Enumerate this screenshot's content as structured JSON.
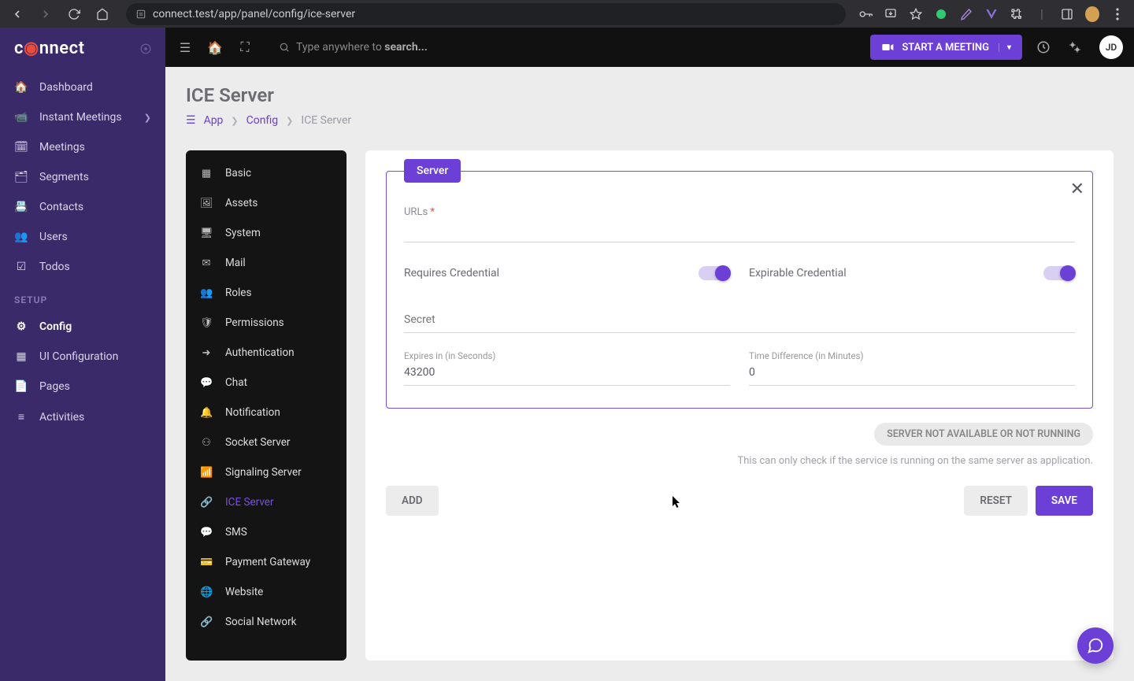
{
  "browser": {
    "url": "connect.test/app/panel/config/ice-server"
  },
  "app": {
    "logo": "connect"
  },
  "sidebar": {
    "items": [
      {
        "icon": "home",
        "label": "Dashboard"
      },
      {
        "icon": "video",
        "label": "Instant Meetings",
        "hasChildren": true
      },
      {
        "icon": "calendar",
        "label": "Meetings"
      },
      {
        "icon": "segments",
        "label": "Segments"
      },
      {
        "icon": "contacts",
        "label": "Contacts"
      },
      {
        "icon": "users",
        "label": "Users"
      },
      {
        "icon": "todos",
        "label": "Todos"
      }
    ],
    "section": "SETUP",
    "setup_items": [
      {
        "icon": "config",
        "label": "Config",
        "active": true
      },
      {
        "icon": "ui",
        "label": "UI Configuration"
      },
      {
        "icon": "pages",
        "label": "Pages"
      },
      {
        "icon": "activities",
        "label": "Activities"
      }
    ]
  },
  "topbar": {
    "search_placeholder": "Type anywhere to",
    "search_strong": "search...",
    "start_meeting": "START A MEETING",
    "user_initials": "JD"
  },
  "page": {
    "title": "ICE Server",
    "breadcrumb": {
      "app": "App",
      "config": "Config",
      "current": "ICE Server"
    }
  },
  "config_nav": [
    {
      "icon": "basic",
      "label": "Basic"
    },
    {
      "icon": "assets",
      "label": "Assets"
    },
    {
      "icon": "system",
      "label": "System"
    },
    {
      "icon": "mail",
      "label": "Mail"
    },
    {
      "icon": "roles",
      "label": "Roles"
    },
    {
      "icon": "permissions",
      "label": "Permissions"
    },
    {
      "icon": "auth",
      "label": "Authentication"
    },
    {
      "icon": "chat",
      "label": "Chat"
    },
    {
      "icon": "notif",
      "label": "Notification"
    },
    {
      "icon": "socket",
      "label": "Socket Server"
    },
    {
      "icon": "signal",
      "label": "Signaling Server"
    },
    {
      "icon": "ice",
      "label": "ICE Server",
      "active": true
    },
    {
      "icon": "sms",
      "label": "SMS"
    },
    {
      "icon": "payment",
      "label": "Payment Gateway"
    },
    {
      "icon": "website",
      "label": "Website"
    },
    {
      "icon": "social",
      "label": "Social Network"
    }
  ],
  "form": {
    "legend": "Server",
    "urls_label": "URLs",
    "requires_credential_label": "Requires Credential",
    "expirable_credential_label": "Expirable Credential",
    "secret_label": "Secret",
    "expires_label": "Expires in (in Seconds)",
    "expires_value": "43200",
    "time_diff_label": "Time Difference (in Minutes)",
    "time_diff_value": "0",
    "status_text": "SERVER NOT AVAILABLE OR NOT RUNNING",
    "status_note": "This can only check if the service is running on the same server as application.",
    "add_btn": "ADD",
    "reset_btn": "RESET",
    "save_btn": "SAVE"
  }
}
